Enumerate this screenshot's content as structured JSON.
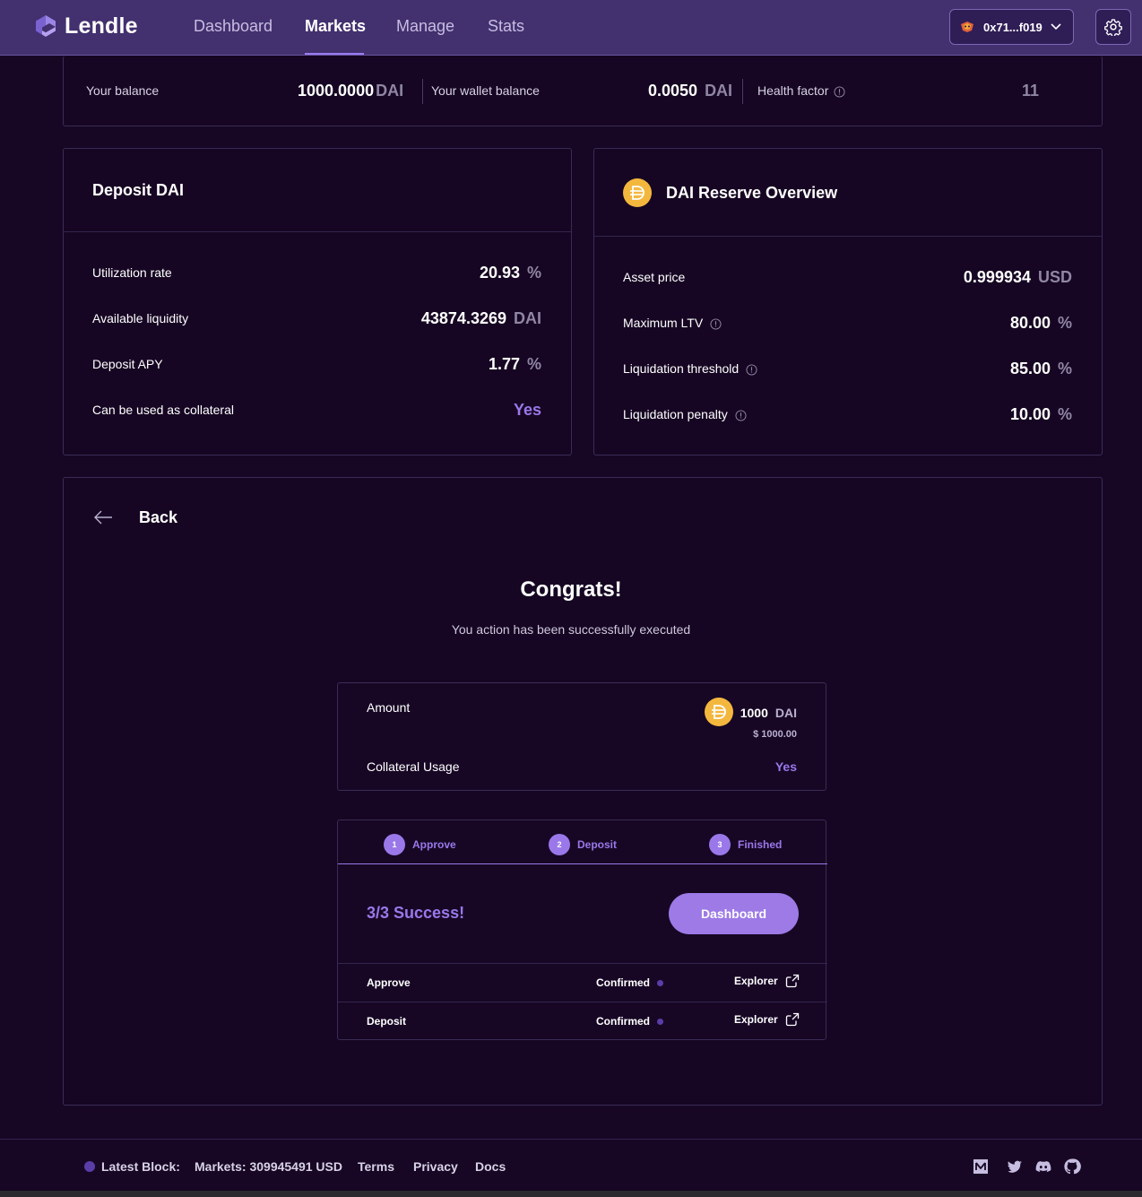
{
  "header": {
    "logo_text": "Lendle",
    "nav": [
      "Dashboard",
      "Markets",
      "Manage",
      "Stats"
    ],
    "active_nav": "Markets",
    "wallet_address": "0x71...f019"
  },
  "balance": {
    "your_balance_label": "Your balance",
    "your_balance_value": "1000.0000",
    "your_balance_unit": "DAI",
    "wallet_balance_label": "Your wallet balance",
    "wallet_balance_value": "0.0050",
    "wallet_balance_unit": "DAI",
    "health_factor_label": "Health factor",
    "health_factor_value": "11"
  },
  "deposit_panel": {
    "title": "Deposit DAI",
    "rows": [
      {
        "label": "Utilization rate",
        "value": "20.93",
        "unit": "%"
      },
      {
        "label": "Available liquidity",
        "value": "43874.3269",
        "unit": "DAI"
      },
      {
        "label": "Deposit APY",
        "value": "1.77",
        "unit": "%"
      },
      {
        "label": "Can be used as collateral",
        "value": "Yes",
        "unit": ""
      }
    ]
  },
  "reserve_panel": {
    "title": "DAI Reserve Overview",
    "rows": [
      {
        "label": "Asset price",
        "value": "0.999934",
        "unit": "USD"
      },
      {
        "label": "Maximum LTV",
        "value": "80.00",
        "unit": "%"
      },
      {
        "label": "Liquidation threshold",
        "value": "85.00",
        "unit": "%"
      },
      {
        "label": "Liquidation penalty",
        "value": "10.00",
        "unit": "%"
      }
    ]
  },
  "main": {
    "back_label": "Back",
    "congrats_title": "Congrats!",
    "congrats_message": "You action has been successfully executed",
    "summary": {
      "amount_label": "Amount",
      "amount_value": "1000",
      "amount_unit": "DAI",
      "amount_usd": "$ 1000.00",
      "collateral_label": "Collateral Usage",
      "collateral_value": "Yes"
    },
    "steps": [
      {
        "num": "1",
        "label": "Approve"
      },
      {
        "num": "2",
        "label": "Deposit"
      },
      {
        "num": "3",
        "label": "Finished"
      }
    ],
    "success_title": "3/3 Success!",
    "dashboard_button": "Dashboard",
    "transactions": [
      {
        "name": "Approve",
        "status": "Confirmed",
        "link": "Explorer"
      },
      {
        "name": "Deposit",
        "status": "Confirmed",
        "link": "Explorer"
      }
    ]
  },
  "footer": {
    "latest_block_label": "Latest Block:",
    "markets_label": "Markets: 309945491 USD",
    "links": [
      "Terms",
      "Privacy",
      "Docs"
    ],
    "social_icons": [
      "medium-icon",
      "twitter-icon",
      "discord-icon",
      "github-icon"
    ]
  },
  "colors": {
    "header_bg": "#43306f",
    "page_bg": "#170725",
    "accent": "#9a78ea",
    "dai_coin": "#f4b73e"
  }
}
